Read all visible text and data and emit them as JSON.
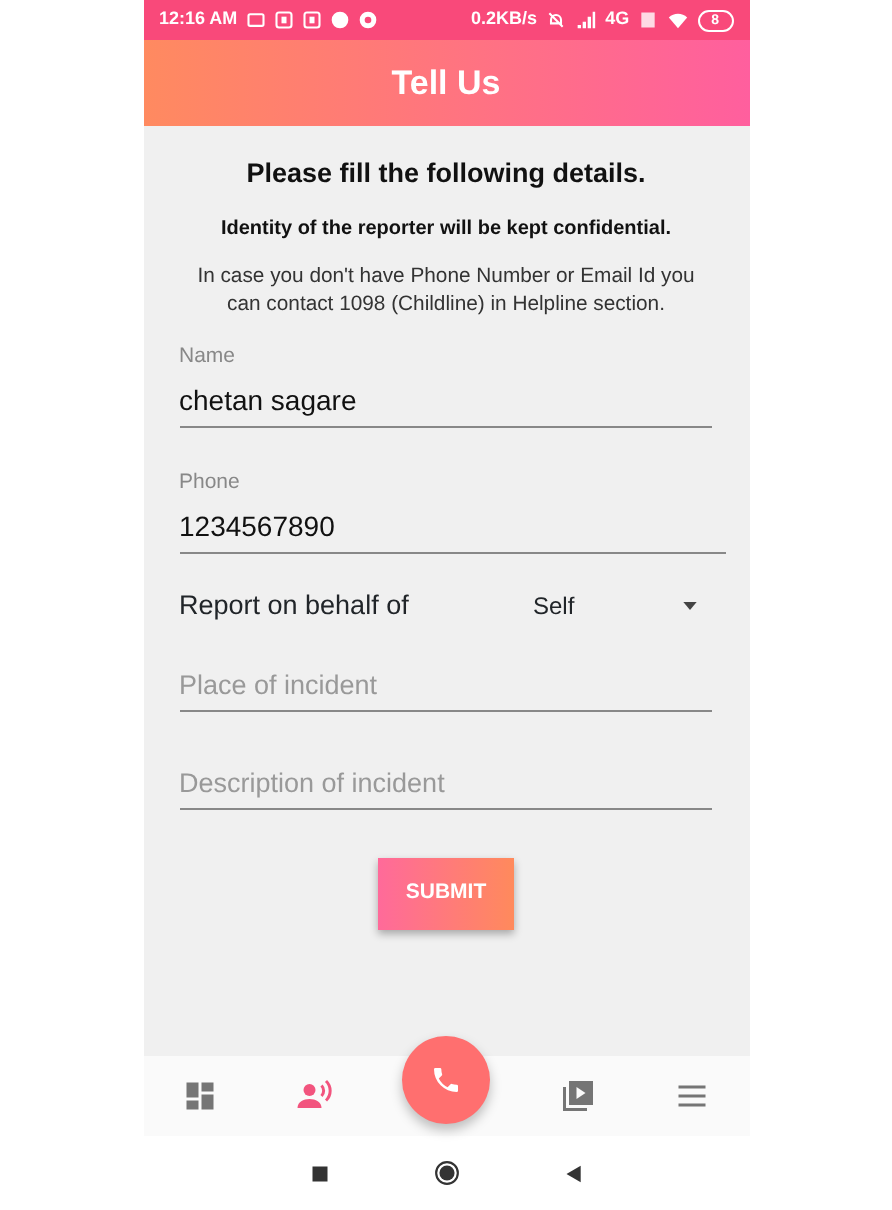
{
  "status_bar": {
    "time": "12:16 AM",
    "speed": "0.2KB/s",
    "network": "4G",
    "battery": "8"
  },
  "header": {
    "title": "Tell Us"
  },
  "intro": {
    "heading": "Please fill the following details.",
    "note": "Identity of the reporter will be kept confidential.",
    "help": "In case you don't have Phone Number or Email Id you can contact 1098 (Childline) in Helpline section."
  },
  "fields": [
    {
      "kind": "text",
      "label": "Name",
      "value": "chetan sagare"
    },
    {
      "kind": "text",
      "label": "Phone",
      "value": "1234567890"
    },
    {
      "kind": "select",
      "label": "Report on behalf of",
      "value": "Self"
    },
    {
      "kind": "empty",
      "placeholder": "Place of incident"
    },
    {
      "kind": "empty",
      "placeholder": "Description of incident"
    }
  ],
  "submit": "SUBMIT",
  "bottom_nav": [
    {
      "kind": "dashboard",
      "selected": false
    },
    {
      "kind": "report",
      "selected": true
    },
    {
      "kind": "call",
      "selected": false
    },
    {
      "kind": "video",
      "selected": false
    },
    {
      "kind": "menu",
      "selected": false
    }
  ]
}
